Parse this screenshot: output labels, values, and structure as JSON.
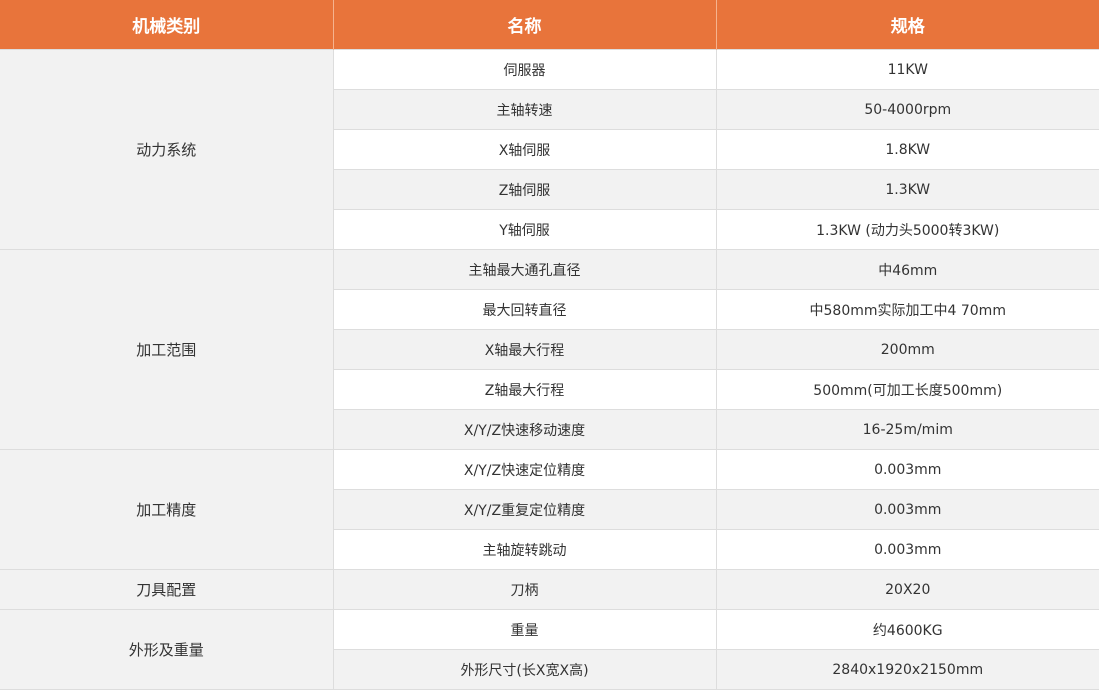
{
  "header": {
    "category": "机械类别",
    "name": "名称",
    "spec": "规格"
  },
  "colors": {
    "header_bg": "#e8743b",
    "header_text": "#ffffff",
    "row_alt": "#f2f2f2"
  },
  "groups": [
    {
      "category": "动力系统",
      "rows": [
        {
          "name": "伺服器",
          "spec": "11KW"
        },
        {
          "name": "主轴转速",
          "spec": "50-4000rpm"
        },
        {
          "name": "X轴伺服",
          "spec": "1.8KW"
        },
        {
          "name": "Z轴伺服",
          "spec": "1.3KW"
        },
        {
          "name": "Y轴伺服",
          "spec": "1.3KW (动力头5000转3KW)"
        }
      ]
    },
    {
      "category": "加工范围",
      "rows": [
        {
          "name": "主轴最大通孔直径",
          "spec": "中46mm"
        },
        {
          "name": "最大回转直径",
          "spec": "中580mm实际加工中4 70mm"
        },
        {
          "name": "X轴最大行程",
          "spec": "200mm"
        },
        {
          "name": "Z轴最大行程",
          "spec": "500mm(可加工长度500mm)"
        },
        {
          "name": "X/Y/Z快速移动速度",
          "spec": "16-25m/mim"
        }
      ]
    },
    {
      "category": "加工精度",
      "rows": [
        {
          "name": "X/Y/Z快速定位精度",
          "spec": "0.003mm"
        },
        {
          "name": "X/Y/Z重复定位精度",
          "spec": "0.003mm"
        },
        {
          "name": "主轴旋转跳动",
          "spec": "0.003mm"
        }
      ]
    },
    {
      "category": "刀具配置",
      "rows": [
        {
          "name": "刀柄",
          "spec": "20X20"
        }
      ]
    },
    {
      "category": "外形及重量",
      "rows": [
        {
          "name": "重量",
          "spec": "约4600KG"
        },
        {
          "name": "外形尺寸(长X宽X高)",
          "spec": "2840x1920x2150mm"
        }
      ]
    }
  ]
}
